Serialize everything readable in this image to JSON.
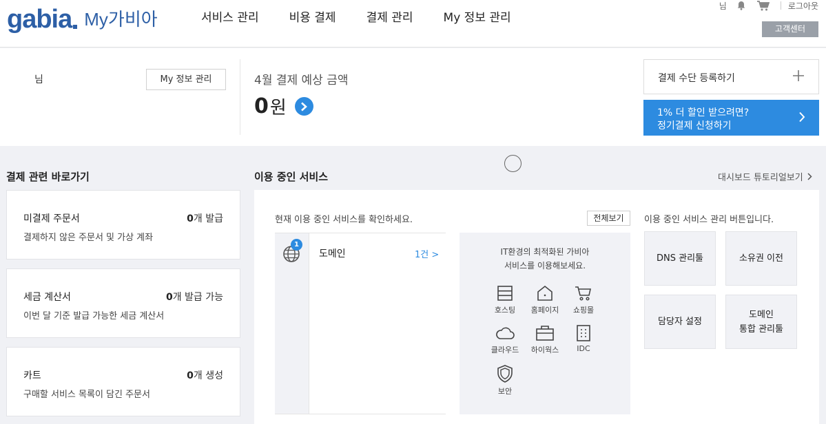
{
  "header": {
    "logo_main": "gabia",
    "logo_sub": "My가비아",
    "nav": [
      "서비스 관리",
      "비용 결제",
      "결제 관리",
      "My 정보 관리"
    ],
    "user_suffix": "님",
    "logout": "로그아웃",
    "customer_center": "고객센터"
  },
  "summary": {
    "user_suffix": "님",
    "myinfo_button": "My 정보 관리",
    "payment_label": "4월 결제 예상 금액",
    "payment_amount": "0",
    "payment_unit": "원",
    "register_method": "결제 수단 등록하기",
    "subscribe_line1": "1% 더 할인 받으려면?",
    "subscribe_line2": "정기결제 신청하기"
  },
  "shortcuts": {
    "title": "결제 관련 바로가기",
    "cards": [
      {
        "name": "미결제 주문서",
        "count": "0",
        "count_suffix": "개 발급",
        "desc": "결제하지 않은 주문서 및 가상 계좌"
      },
      {
        "name": "세금 계산서",
        "count": "0",
        "count_suffix": "개 발급 가능",
        "desc": "이번 달 기준 발급 가능한 세금 계산서"
      },
      {
        "name": "카트",
        "count": "0",
        "count_suffix": "개 생성",
        "desc": "구매할 서비스 목록이 담긴 주문서"
      }
    ]
  },
  "services": {
    "title": "이용 중인 서비스",
    "tutorial": "대시보드 튜토리얼보기",
    "desc": "현재 이용 중인 서비스를 확인하세요.",
    "view_all": "전체보기",
    "list": [
      {
        "name": "도메인",
        "badge": "1",
        "count": "1건 >"
      }
    ],
    "promo_line1": "IT환경의 최적화된 가비아",
    "promo_line2": "서비스를 이용해보세요.",
    "promo_items": [
      {
        "label": "호스팅",
        "icon": "hosting-icon"
      },
      {
        "label": "홈페이지",
        "icon": "homepage-icon"
      },
      {
        "label": "쇼핑몰",
        "icon": "cart-icon"
      },
      {
        "label": "클라우드",
        "icon": "cloud-icon"
      },
      {
        "label": "하이웍스",
        "icon": "briefcase-icon"
      },
      {
        "label": "IDC",
        "icon": "building-icon"
      },
      {
        "label": "보안",
        "icon": "shield-icon"
      }
    ],
    "manage_desc": "이용 중인 서비스 관리 버튼입니다.",
    "manage_buttons": [
      {
        "line1": "DNS 관리툴",
        "line2": ""
      },
      {
        "line1": "소유권 이전",
        "line2": ""
      },
      {
        "line1": "담당자 설정",
        "line2": ""
      },
      {
        "line1": "도메인",
        "line2": "통합 관리툴"
      }
    ]
  },
  "colors": {
    "brand": "#2d5fa6",
    "accent": "#2d8be0",
    "panel_bg": "#f1f2f6"
  }
}
